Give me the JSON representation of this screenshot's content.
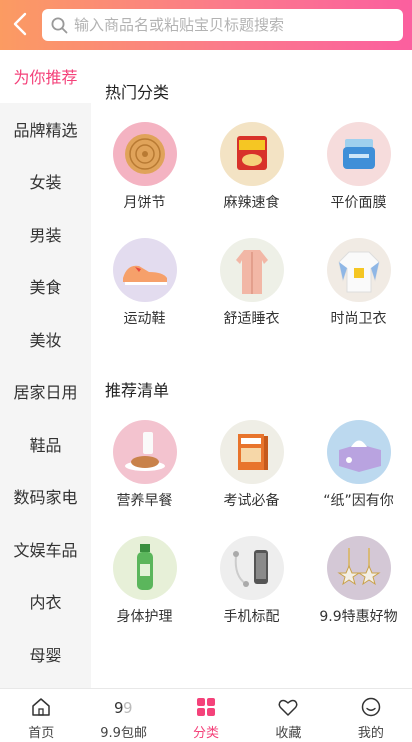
{
  "header": {
    "search_placeholder": "输入商品名或粘贴宝贝标题搜索"
  },
  "sidebar": {
    "items": [
      {
        "label": "为你推荐"
      },
      {
        "label": "品牌精选"
      },
      {
        "label": "女装"
      },
      {
        "label": "男装"
      },
      {
        "label": "美食"
      },
      {
        "label": "美妆"
      },
      {
        "label": "居家日用"
      },
      {
        "label": "鞋品"
      },
      {
        "label": "数码家电"
      },
      {
        "label": "文娱车品"
      },
      {
        "label": "内衣"
      },
      {
        "label": "母婴"
      }
    ],
    "active_label": "为你推荐"
  },
  "sections": [
    {
      "title": "热门分类",
      "items": [
        {
          "label": "月饼节",
          "icon": "mooncake-icon"
        },
        {
          "label": "麻辣速食",
          "icon": "spicy-noodles-icon"
        },
        {
          "label": "平价面膜",
          "icon": "face-mask-jar-icon"
        },
        {
          "label": "运动鞋",
          "icon": "sneaker-icon"
        },
        {
          "label": "舒适睡衣",
          "icon": "pajamas-icon"
        },
        {
          "label": "时尚卫衣",
          "icon": "hoodie-icon"
        }
      ]
    },
    {
      "title": "推荐清单",
      "items": [
        {
          "label": "营养早餐",
          "icon": "breakfast-icon"
        },
        {
          "label": "考试必备",
          "icon": "exam-books-icon"
        },
        {
          "label": "“纸”因有你",
          "icon": "tissue-box-icon"
        },
        {
          "label": "身体护理",
          "icon": "body-lotion-icon"
        },
        {
          "label": "手机标配",
          "icon": "earphones-phone-icon"
        },
        {
          "label": "9.9特惠好物",
          "icon": "star-earrings-icon"
        }
      ]
    }
  ],
  "tabbar": {
    "items": [
      {
        "label": "首页",
        "icon": "home-icon"
      },
      {
        "label": "9.9包邮",
        "icon": "nine-nine-icon"
      },
      {
        "label": "分类",
        "icon": "category-grid-icon"
      },
      {
        "label": "收藏",
        "icon": "heart-icon"
      },
      {
        "label": "我的",
        "icon": "smiley-user-icon"
      }
    ],
    "active_label": "分类"
  },
  "colors": {
    "accent": "#f4427a",
    "header_gradient_start": "#fb9b62",
    "header_gradient_end": "#fb5f9f",
    "sidebar_bg": "#f5f5f5"
  }
}
